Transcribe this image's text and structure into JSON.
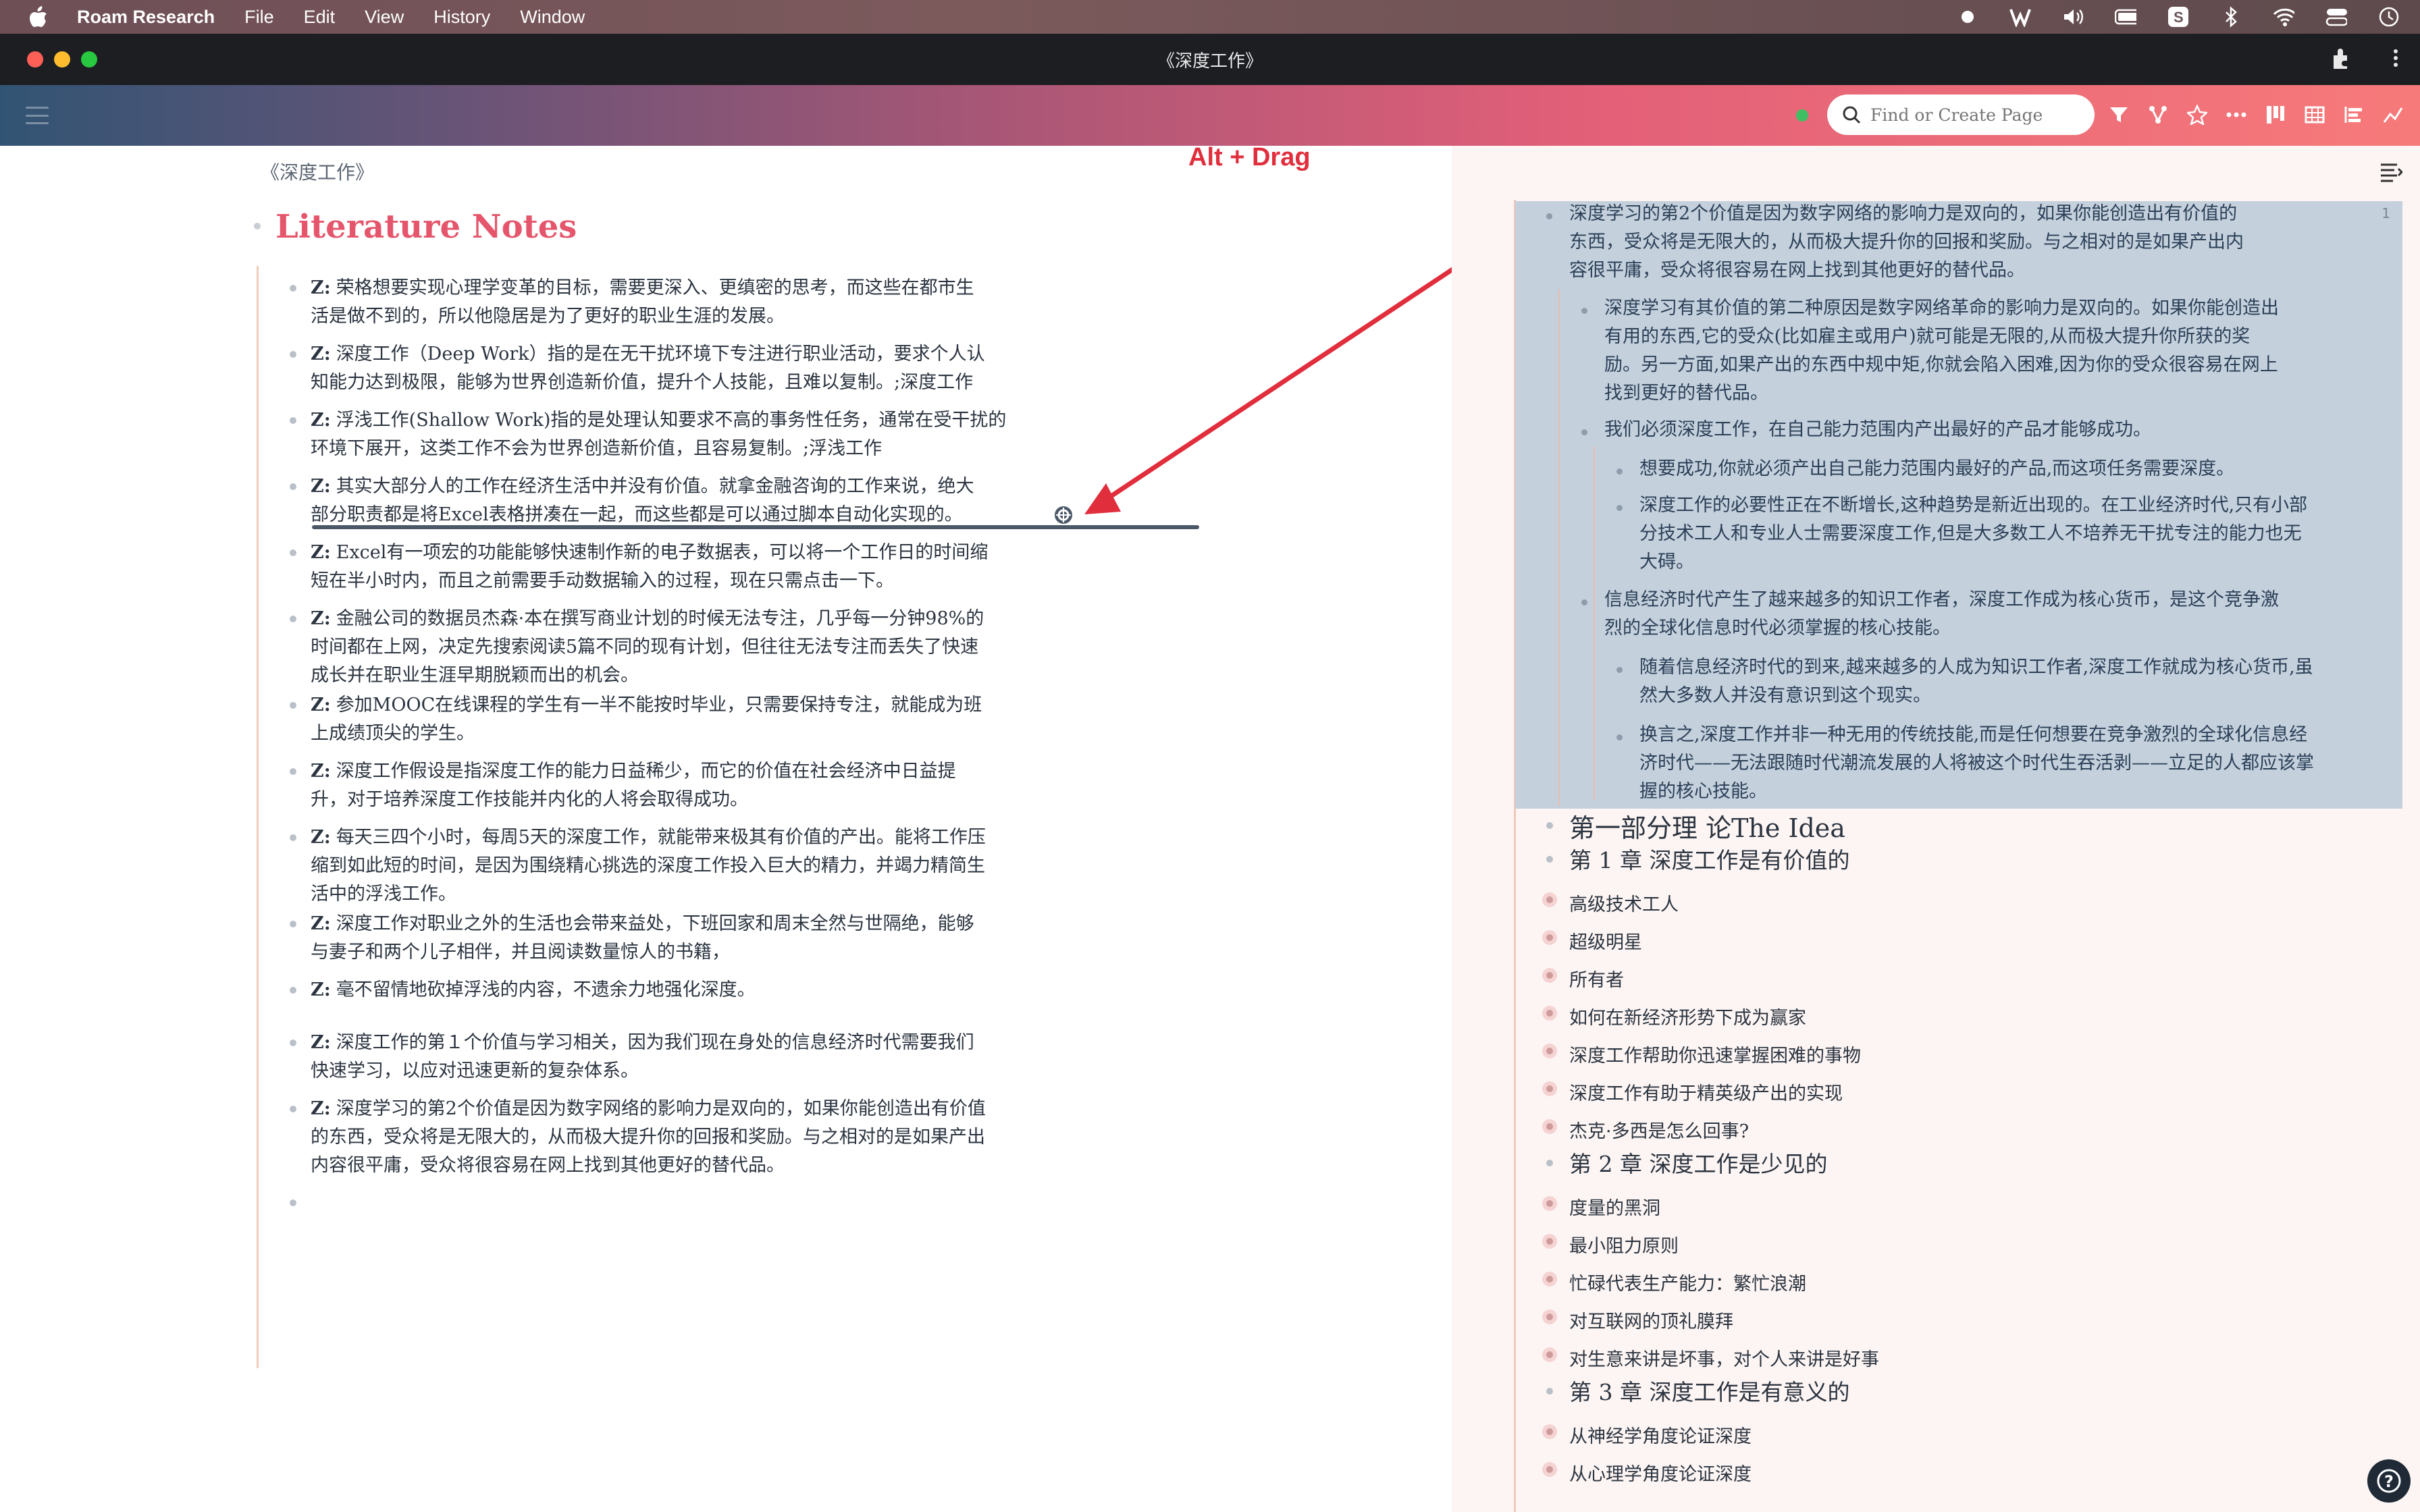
{
  "menubar": {
    "app_name": "Roam Research",
    "menus": [
      "File",
      "Edit",
      "View",
      "History",
      "Window"
    ]
  },
  "window": {
    "title": "《深度工作》"
  },
  "topbar": {
    "search_placeholder": "Find or Create Page"
  },
  "main": {
    "breadcrumb": "《深度工作》",
    "page_title": "Literature Notes",
    "blocks": [
      {
        "tag": "Z:",
        "lines": [
          "荣格想要实现心理学变革的目标，需要更深入、更缜密的思考，而这些在都市生",
          "活是做不到的，所以他隐居是为了更好的职业生涯的发展。"
        ]
      },
      {
        "tag": "Z:",
        "lines": [
          "深度工作（Deep Work）指的是在无干扰环境下专注进行职业活动，要求个人认",
          "知能力达到极限，能够为世界创造新价值，提升个人技能，且难以复制。;深度工作"
        ]
      },
      {
        "tag": "Z:",
        "lines": [
          "浮浅工作(Shallow Work)指的是处理认知要求不高的事务性任务，通常在受干扰的",
          "环境下展开，这类工作不会为世界创造新价值，且容易复制。;浮浅工作"
        ]
      },
      {
        "tag": "Z:",
        "lines": [
          "其实大部分人的工作在经济生活中并没有价值。就拿金融咨询的工作来说，绝大",
          "部分职责都是将Excel表格拼凑在一起，而这些都是可以通过脚本自动化实现的。"
        ]
      },
      {
        "tag": "Z:",
        "lines": [
          "Excel有一项宏的功能能够快速制作新的电子数据表，可以将一个工作日的时间缩",
          "短在半小时内，而且之前需要手动数据输入的过程，现在只需点击一下。"
        ]
      },
      {
        "tag": "Z:",
        "lines": [
          "金融公司的数据员杰森·本在撰写商业计划的时候无法专注，几乎每一分钟98%的",
          "时间都在上网，决定先搜索阅读5篇不同的现有计划，但往往无法专注而丢失了快速",
          "成长并在职业生涯早期脱颖而出的机会。"
        ]
      },
      {
        "tag": "Z:",
        "lines": [
          "参加MOOC在线课程的学生有一半不能按时毕业，只需要保持专注，就能成为班",
          "上成绩顶尖的学生。"
        ]
      },
      {
        "tag": "Z:",
        "lines": [
          "深度工作假设是指深度工作的能力日益稀少，而它的价值在社会经济中日益提",
          "升，对于培养深度工作技能并内化的人将会取得成功。"
        ]
      },
      {
        "tag": "Z:",
        "lines": [
          "每天三四个小时，每周5天的深度工作，就能带来极其有价值的产出。能将工作压",
          "缩到如此短的时间，是因为围绕精心挑选的深度工作投入巨大的精力，并竭力精简生",
          "活中的浮浅工作。"
        ]
      },
      {
        "tag": "Z:",
        "lines": [
          "深度工作对职业之外的生活也会带来益处，下班回家和周末全然与世隔绝，能够",
          "与妻子和两个儿子相伴，并且阅读数量惊人的书籍，"
        ]
      },
      {
        "tag": "Z:",
        "lines": [
          "毫不留情地砍掉浮浅的内容，不遗余力地强化深度。"
        ]
      },
      {
        "tag": "Z:",
        "lines": [
          "深度工作的第１个价值与学习相关，因为我们现在身处的信息经济时代需要我们",
          "快速学习，以应对迅速更新的复杂体系。"
        ]
      },
      {
        "tag": "Z:",
        "lines": [
          "深度学习的第2个价值是因为数字网络的影响力是双向的，如果你能创造出有价值",
          "的东西，受众将是无限大的，从而极大提升你的回报和奖励。与之相对的是如果产出",
          "内容很平庸，受众将很容易在网上找到其他更好的替代品。"
        ]
      }
    ]
  },
  "annotation": {
    "label": "Alt + Drag"
  },
  "sidebar": {
    "selection_count": "1",
    "selected": {
      "root_lines": [
        "深度学习的第2个价值是因为数字网络的影响力是双向的，如果你能创造出有价值的",
        "东西，受众将是无限大的，从而极大提升你的回报和奖励。与之相对的是如果产出内",
        "容很平庸，受众将很容易在网上找到其他更好的替代品。"
      ],
      "child1_lines": [
        "深度学习有其价值的第二种原因是数字网络革命的影响力是双向的。如果你能创造出",
        "有用的东西,它的受众(比如雇主或用户)就可能是无限的,从而极大提升你所获的奖",
        "励。另一方面,如果产出的东西中规中矩,你就会陷入困难,因为你的受众很容易在网上",
        "找到更好的替代品。"
      ],
      "child2_line": "我们必须深度工作，在自己能力范围内产出最好的产品才能够成功。",
      "child2_sub1": "想要成功,你就必须产出自己能力范围内最好的产品,而这项任务需要深度。",
      "child2_sub2_lines": [
        "深度工作的必要性正在不断增长,这种趋势是新近出现的。在工业经济时代,只有小部",
        "分技术工人和专业人士需要深度工作,但是大多数工人不培养无干扰专注的能力也无",
        "大碍。"
      ],
      "child3_lines": [
        "信息经济时代产生了越来越多的知识工作者，深度工作成为核心货币，是这个竞争激",
        "烈的全球化信息时代必须掌握的核心技能。"
      ],
      "child3_sub1_lines": [
        "随着信息经济时代的到来,越来越多的人成为知识工作者,深度工作就成为核心货币,虽",
        "然大多数人并没有意识到这个现实。"
      ],
      "child3_sub2_lines": [
        "换言之,深度工作并非一种无用的传统技能,而是任何想要在竞争激烈的全球化信息经",
        "济时代——无法跟随时代潮流发展的人将被这个时代生吞活剥——立足的人都应该掌",
        "握的核心技能。"
      ]
    },
    "part1_heading": "第一部分理 论The Idea",
    "chapters": [
      {
        "title": "第 1 章 深度工作是有价值的",
        "items": [
          "高级技术工人",
          "超级明星",
          "所有者",
          "如何在新经济形势下成为赢家",
          "深度工作帮助你迅速掌握困难的事物",
          "深度工作有助于精英级产出的实现",
          "杰克·多西是怎么回事?"
        ]
      },
      {
        "title": "第 2 章 深度工作是少见的",
        "items": [
          "度量的黑洞",
          "最小阻力原则",
          "忙碌代表生产能力：繁忙浪潮",
          "对互联网的顶礼膜拜",
          "对生意来讲是坏事，对个人来讲是好事"
        ]
      },
      {
        "title": "第 3 章 深度工作是有意义的",
        "items": [
          "从神经学角度论证深度",
          "从心理学角度论证深度"
        ]
      }
    ]
  },
  "colors": {
    "title": "#e5566c",
    "annotation": "#e12e3c",
    "selection": "#c4d0dc"
  }
}
